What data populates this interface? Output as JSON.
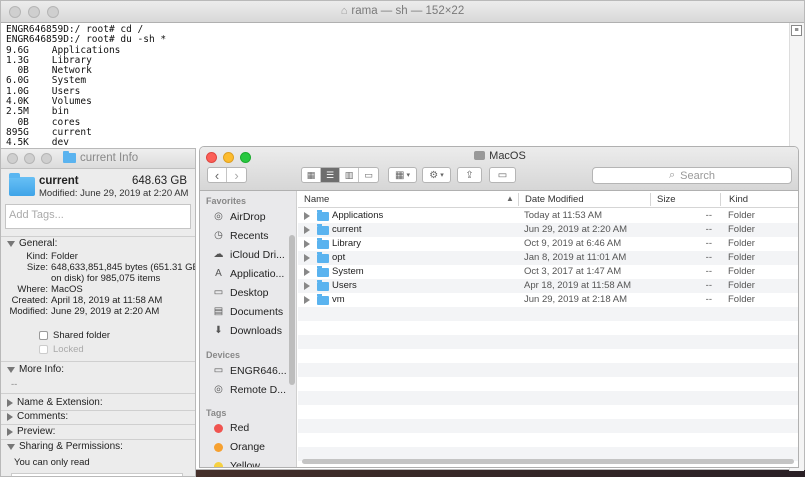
{
  "terminal": {
    "title": "rama — sh — 152×22",
    "lines": [
      "ENGR646859D:/ root# cd /",
      "ENGR646859D:/ root# du -sh *",
      "9.6G\tApplications",
      "1.3G\tLibrary",
      "  0B\tNetwork",
      "6.0G\tSystem",
      "1.0G\tUsers",
      "4.0K\tVolumes",
      "2.5M\tbin",
      "  0B\tcores",
      "895G\tcurrent",
      "4.5K\tdev"
    ]
  },
  "info": {
    "window_title": "current Info",
    "name": "current",
    "size": "648.63 GB",
    "modified_line": "Modified: June 29, 2019 at 2:20 AM",
    "tags_placeholder": "Add Tags...",
    "general_label": "General:",
    "general": [
      {
        "key": "Kind:",
        "value": "Folder"
      },
      {
        "key": "Size:",
        "value": "648,633,851,845 bytes (651.31 GB"
      },
      {
        "key": "",
        "value": "on disk) for 985,075 items"
      },
      {
        "key": "Where:",
        "value": "MacOS"
      },
      {
        "key": "Created:",
        "value": "April 18, 2019 at 11:58 AM"
      },
      {
        "key": "Modified:",
        "value": "June 29, 2019 at 2:20 AM"
      }
    ],
    "shared_folder": "Shared folder",
    "locked": "Locked",
    "more_info": "More Info:",
    "more_info_value": "--",
    "name_ext": "Name & Extension:",
    "comments": "Comments:",
    "preview": "Preview:",
    "sharing": "Sharing & Permissions:",
    "sharing_note": "You can only read"
  },
  "finder": {
    "title": "MacOS",
    "search_placeholder": "Search",
    "sidebar": {
      "favorites_label": "Favorites",
      "favorites": [
        {
          "label": "AirDrop",
          "icon": "airdrop-icon"
        },
        {
          "label": "Recents",
          "icon": "clock-icon"
        },
        {
          "label": "iCloud Dri...",
          "icon": "cloud-icon"
        },
        {
          "label": "Applicatio...",
          "icon": "apps-icon"
        },
        {
          "label": "Desktop",
          "icon": "desktop-icon"
        },
        {
          "label": "Documents",
          "icon": "document-icon"
        },
        {
          "label": "Downloads",
          "icon": "download-icon"
        }
      ],
      "devices_label": "Devices",
      "devices": [
        {
          "label": "ENGR646...",
          "icon": "computer-icon"
        },
        {
          "label": "Remote D...",
          "icon": "disc-icon"
        }
      ],
      "tags_label": "Tags",
      "tags": [
        {
          "label": "Red",
          "color": "#f05450"
        },
        {
          "label": "Orange",
          "color": "#f6a030"
        },
        {
          "label": "Yellow",
          "color": "#f6d040"
        }
      ]
    },
    "columns": {
      "name": "Name",
      "date": "Date Modified",
      "size": "Size",
      "kind": "Kind"
    },
    "rows": [
      {
        "name": "Applications",
        "date": "Today at 11:53 AM",
        "size": "--",
        "kind": "Folder"
      },
      {
        "name": "current",
        "date": "Jun 29, 2019 at 2:20 AM",
        "size": "--",
        "kind": "Folder"
      },
      {
        "name": "Library",
        "date": "Oct 9, 2019 at 6:46 AM",
        "size": "--",
        "kind": "Folder"
      },
      {
        "name": "opt",
        "date": "Jan 8, 2019 at 11:01 AM",
        "size": "--",
        "kind": "Folder"
      },
      {
        "name": "System",
        "date": "Oct 3, 2017 at 1:47 AM",
        "size": "--",
        "kind": "Folder"
      },
      {
        "name": "Users",
        "date": "Apr 18, 2019 at 11:58 AM",
        "size": "--",
        "kind": "Folder"
      },
      {
        "name": "vm",
        "date": "Jun 29, 2019 at 2:18 AM",
        "size": "--",
        "kind": "Folder"
      }
    ]
  }
}
